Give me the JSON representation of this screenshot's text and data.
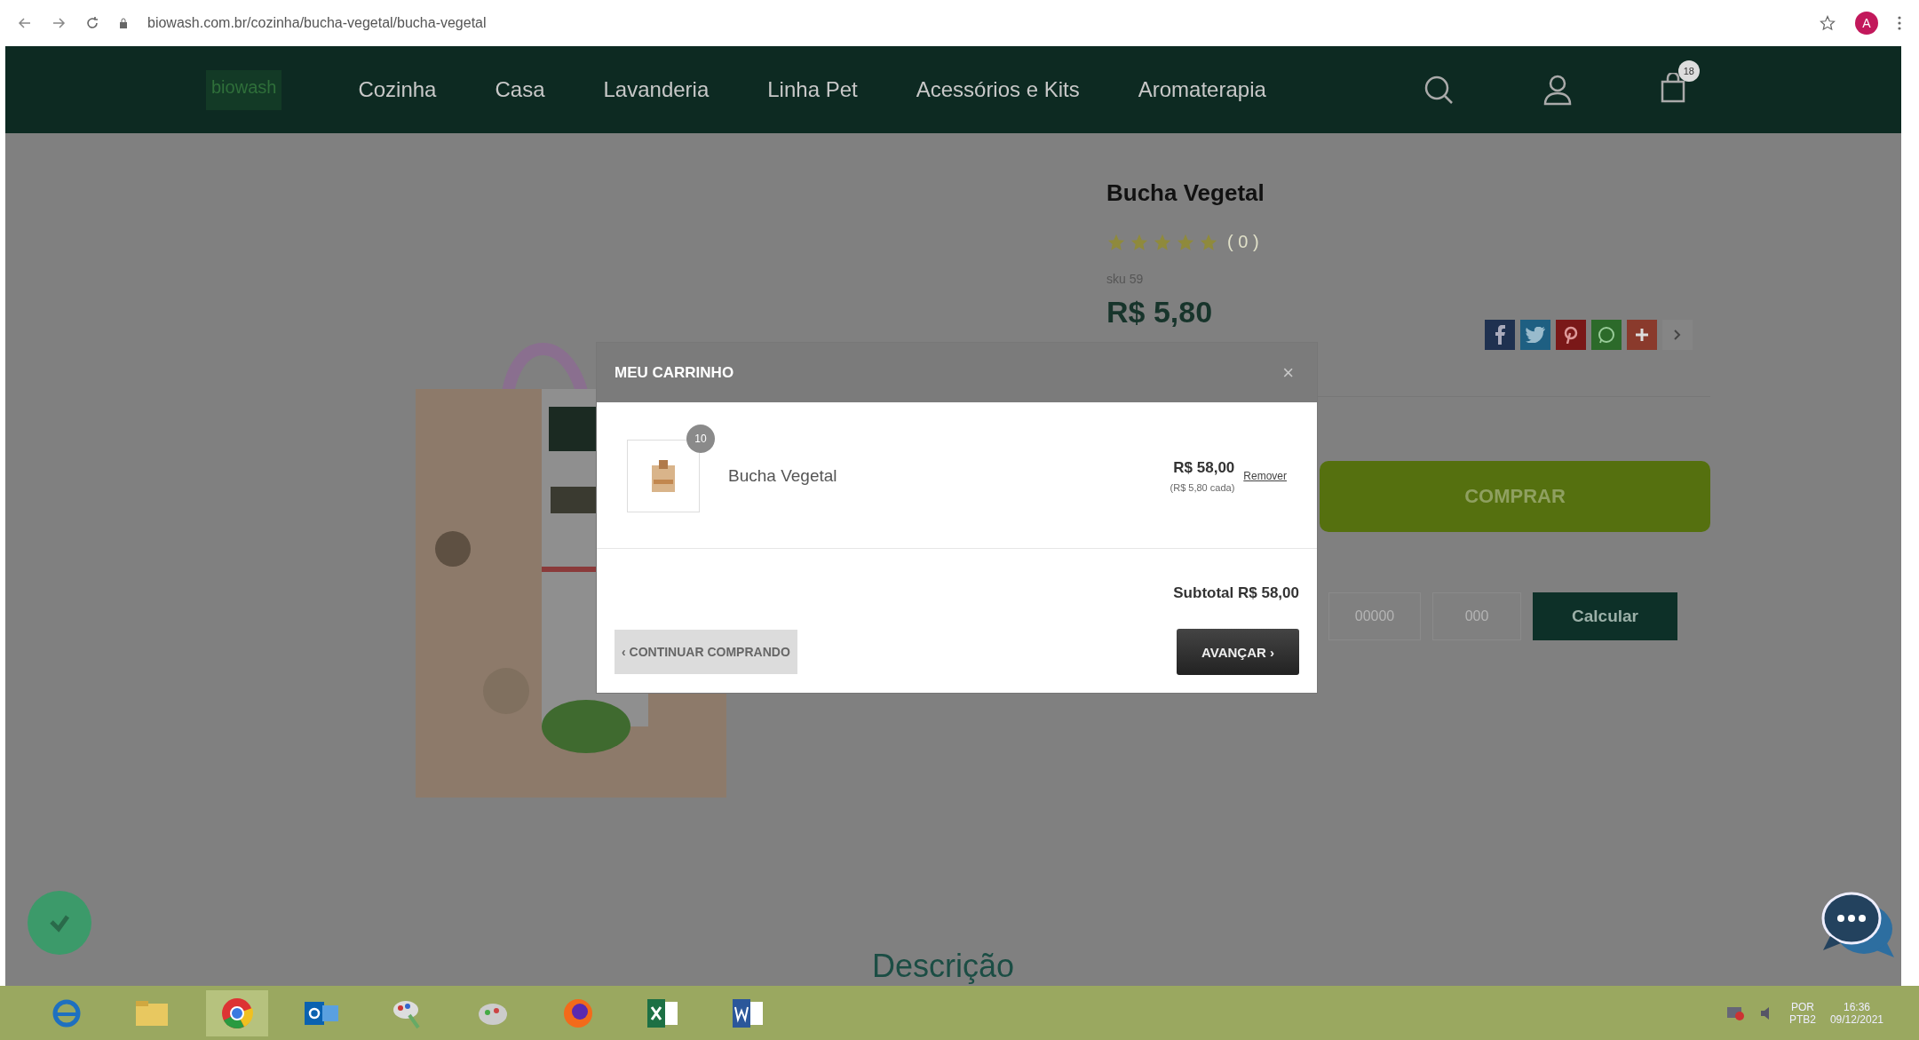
{
  "browser": {
    "url": "biowash.com.br/cozinha/bucha-vegetal/bucha-vegetal",
    "profile_initial": "A"
  },
  "nav": {
    "logo": "biowash",
    "items": [
      "Cozinha",
      "Casa",
      "Lavanderia",
      "Linha Pet",
      "Acessórios e Kits",
      "Aromaterapia"
    ],
    "cart_count": "18"
  },
  "product": {
    "title": "Bucha Vegetal",
    "stars": 5,
    "review_count": "( 0 )",
    "sku": "sku 59",
    "price": "R$ 5,80",
    "buy_button": "COMPRAR",
    "zip_placeholder": "00000",
    "zip_suffix_placeholder": "000",
    "calculate_button": "Calcular",
    "description_heading": "Descrição"
  },
  "cart_modal": {
    "title": "MEU CARRINHO",
    "close": "×",
    "items": [
      {
        "quantity": "10",
        "name": "Bucha Vegetal",
        "total": "R$ 58,00",
        "unit": "(R$ 5,80 cada)",
        "remove": "Remover"
      }
    ],
    "subtotal": "Subtotal R$ 58,00",
    "continue_button": "CONTINUAR COMPRANDO",
    "continue_caret": "‹",
    "advance_button": "AVANÇAR",
    "advance_caret": "›"
  },
  "taskbar": {
    "language": "POR",
    "layout": "PTB2",
    "time": "16:36",
    "date": "09/12/2021"
  }
}
